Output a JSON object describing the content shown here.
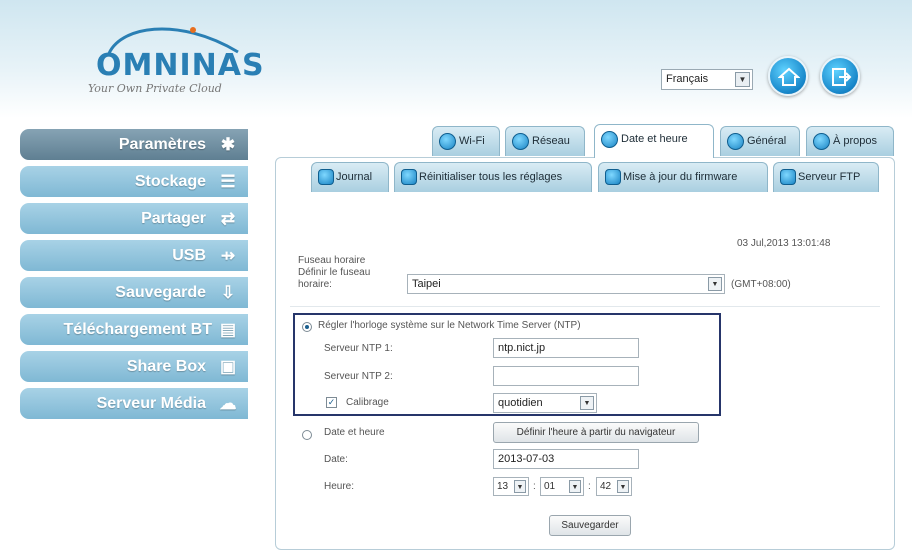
{
  "brand": {
    "name": "OMNINAS",
    "tagline": "Your Own Private Cloud"
  },
  "header": {
    "language": "Français",
    "home_icon": "home-icon",
    "logout_icon": "logout-icon"
  },
  "sidebar": {
    "items": [
      {
        "label": "Paramètres",
        "icon": "settings-icon",
        "active": true
      },
      {
        "label": "Stockage",
        "icon": "storage-icon"
      },
      {
        "label": "Partager",
        "icon": "share-icon"
      },
      {
        "label": "USB",
        "icon": "usb-icon"
      },
      {
        "label": "Sauvegarde",
        "icon": "backup-icon"
      },
      {
        "label": "Téléchargement BT",
        "icon": "bt-download-icon"
      },
      {
        "label": "Share Box",
        "icon": "sharebox-icon"
      },
      {
        "label": "Serveur Média",
        "icon": "media-server-icon"
      }
    ]
  },
  "tabs": [
    {
      "label": "Wi-Fi"
    },
    {
      "label": "Réseau"
    },
    {
      "label": "Date et heure",
      "active": true
    },
    {
      "label": "Général"
    },
    {
      "label": "À propos"
    }
  ],
  "subtabs": [
    {
      "label": "Journal"
    },
    {
      "label": "Réinitialiser tous les réglages"
    },
    {
      "label": "Mise à jour du firmware"
    },
    {
      "label": "Serveur FTP"
    }
  ],
  "form": {
    "current_datetime": "03 Jul,2013 13:01:48",
    "timezone_section": "Fuseau horaire",
    "timezone_label_1": "Définir le fuseau",
    "timezone_label_2": "horaire:",
    "timezone_value": "Taipei",
    "timezone_offset": "(GMT+08:00)",
    "ntp_option": "Régler l'horloge système sur le Network Time Server (NTP)",
    "ntp1_label": "Serveur NTP 1:",
    "ntp1_value": "ntp.nict.jp",
    "ntp2_label": "Serveur NTP 2:",
    "ntp2_value": "",
    "calibration_label": "Calibrage",
    "calibration_value": "quotidien",
    "manual_option": "Date et heure",
    "browser_button": "Définir l'heure à partir du navigateur",
    "date_label": "Date:",
    "date_value": "2013-07-03",
    "time_label": "Heure:",
    "hour": "13",
    "minute": "01",
    "second": "42",
    "time_sep": ":",
    "save_button": "Sauvegarder"
  },
  "colors": {
    "accent": "#2a7fb4",
    "sidebar": "#8fc3dc",
    "sidebar_active": "#6d8da0",
    "highlight_border": "#26356a"
  }
}
